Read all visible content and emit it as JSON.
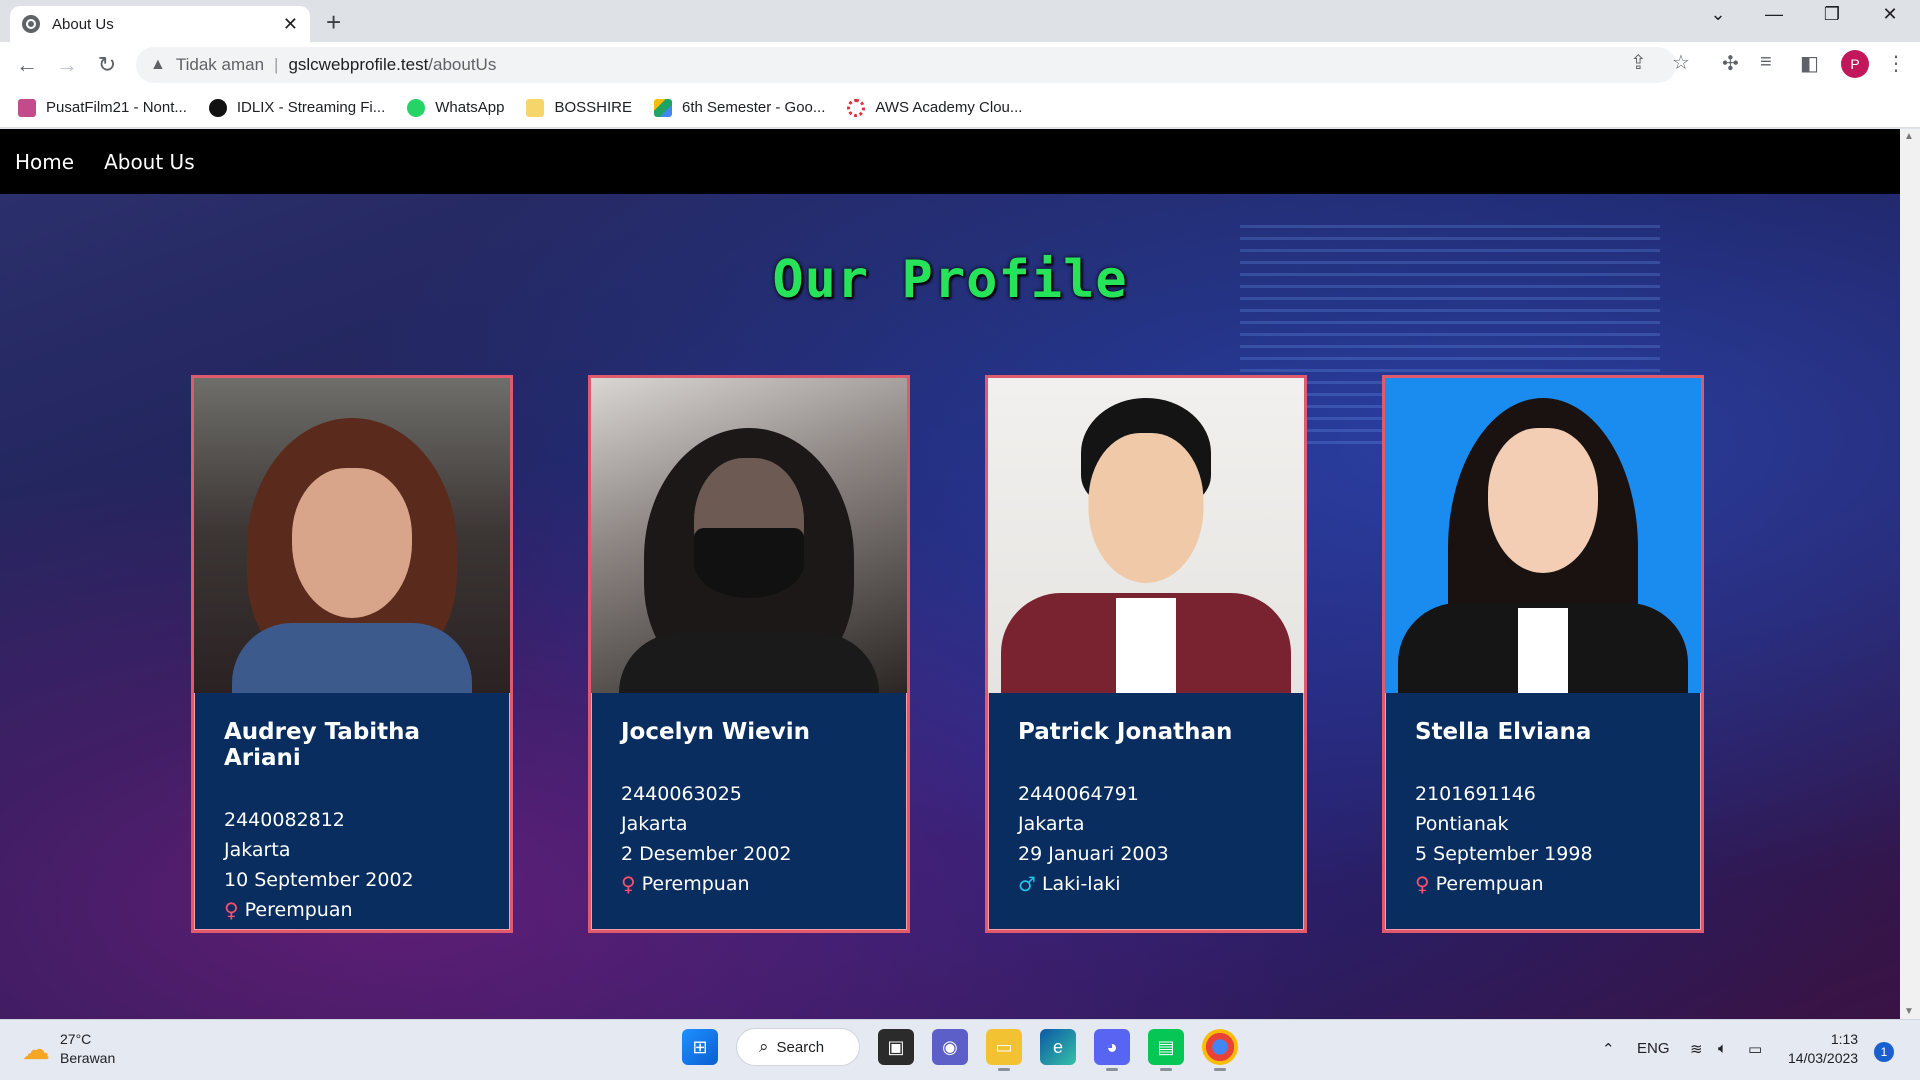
{
  "browser": {
    "tab_title": "About Us",
    "security_label": "Tidak aman",
    "url_host": "gslcwebprofile.test",
    "url_path": "/aboutUs",
    "profile_initial": "P",
    "bookmarks": [
      {
        "label": "PusatFilm21 - Nont...",
        "color": "#c44b8b"
      },
      {
        "label": "IDLIX - Streaming Fi...",
        "color": "#111111"
      },
      {
        "label": "WhatsApp",
        "color": "#25d366"
      },
      {
        "label": "BOSSHIRE",
        "color": "#f6d56a"
      },
      {
        "label": "6th Semester - Goo...",
        "color": "#1fa463"
      },
      {
        "label": "AWS Academy Clou...",
        "color": "#e0303a"
      }
    ]
  },
  "site": {
    "nav": [
      {
        "label": "Home"
      },
      {
        "label": "About Us"
      }
    ],
    "heading": "Our Profile",
    "profiles": [
      {
        "name": "Audrey Tabitha Ariani",
        "nim": "2440082812",
        "city": "Jakarta",
        "birth_date": "10 September 2002",
        "gender": "Perempuan",
        "gender_icon": "female-icon"
      },
      {
        "name": "Jocelyn Wievin",
        "nim": "2440063025",
        "city": "Jakarta",
        "birth_date": "2 Desember 2002",
        "gender": "Perempuan",
        "gender_icon": "female-icon"
      },
      {
        "name": "Patrick Jonathan",
        "nim": "2440064791",
        "city": "Jakarta",
        "birth_date": "29 Januari 2003",
        "gender": "Laki-laki",
        "gender_icon": "male-icon"
      },
      {
        "name": "Stella Elviana",
        "nim": "2101691146",
        "city": "Pontianak",
        "birth_date": "5 September 1998",
        "gender": "Perempuan",
        "gender_icon": "female-icon"
      }
    ]
  },
  "taskbar": {
    "weather_temp": "27°C",
    "weather_desc": "Berawan",
    "search_label": "Search",
    "language": "ENG",
    "time": "1:13",
    "date": "14/03/2023",
    "notification_count": "1"
  }
}
